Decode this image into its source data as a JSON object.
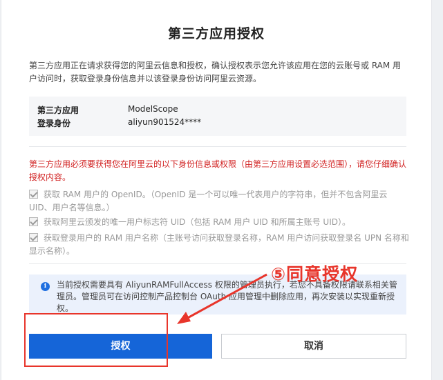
{
  "dialog": {
    "title": "第三方应用授权",
    "intro": "第三方应用正在请求获得您的阿里云信息和授权，确认授权表示您允许该应用在您的云账号或 RAM 用户访问时，获取登录身份信息并以该登录身份访问阿里云资源。",
    "app_label": "第三方应用",
    "app_value": "ModelScope",
    "identity_label": "登录身份",
    "identity_value": "aliyun901524****",
    "warning": "第三方应用必须要获得您在阿里云的以下身份信息或权限（由第三方应用设置必选范围），请您仔细确认授权内容。",
    "permissions": [
      {
        "label": "获取 RAM 用户的 OpenID。（OpenID 是一个可以唯一代表用户的字符串，但并不包含阿里云 UID、用户名等信息。）",
        "checked": true
      },
      {
        "label": "获取阿里云颁发的唯一用户标志符 UID（包括 RAM 用户 UID 和所属主账号 UID）。",
        "checked": true
      },
      {
        "label": "获取登录用户的 RAM 用户名称（主账号访问获取登录名称，RAM 用户访问获取登录名 UPN 名称和显示名称）。",
        "checked": true
      }
    ],
    "notice": "当前授权需要具有 AliyunRAMFullAccess 权限的管理员执行，若您不具备权限请联系相关管理员。管理员可在访问控制产品控制台 OAuth 应用管理中删除应用，再次安装以实现重新授权。",
    "authorize_label": "授权",
    "cancel_label": "取消"
  },
  "annotation": {
    "text": "⑤同意授权",
    "color": "#e8352b"
  },
  "colors": {
    "primary": "#1565d8",
    "warning": "#d12020",
    "notice_bg": "#ebf1fc"
  }
}
